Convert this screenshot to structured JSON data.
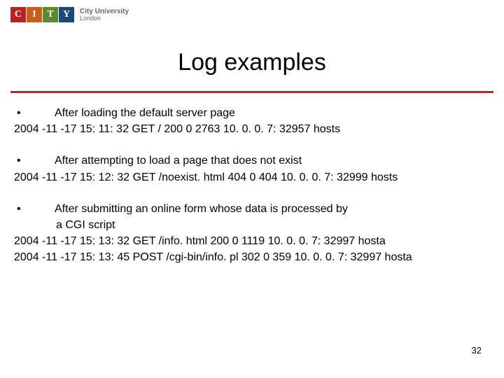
{
  "logo": {
    "tiles": [
      "C",
      "I",
      "T",
      "Y"
    ],
    "line1": "City University",
    "line2": "London"
  },
  "title": "Log examples",
  "items": [
    {
      "lead": "After loading the default server page",
      "lines": [
        "2004 -11 -17 15: 11: 32 GET / 200 0 2763 10. 0. 0. 7: 32957 hosts"
      ]
    },
    {
      "lead": "After attempting to load a page that does not exist",
      "lines": [
        "2004 -11 -17 15: 12: 32 GET /noexist. html 404 0 404 10. 0. 0. 7: 32999 hosts"
      ]
    },
    {
      "lead": "After submitting an online form whose data is processed by",
      "lead_cont": "a CGI script",
      "lines": [
        "2004 -11 -17 15: 13: 32 GET /info. html 200 0 1119 10. 0. 0. 7: 32997 hosta",
        "2004 -11 -17 15: 13: 45 POST /cgi-bin/info. pl 302 0 359 10. 0. 0. 7: 32997 hosta"
      ]
    }
  ],
  "pageNumber": "32"
}
